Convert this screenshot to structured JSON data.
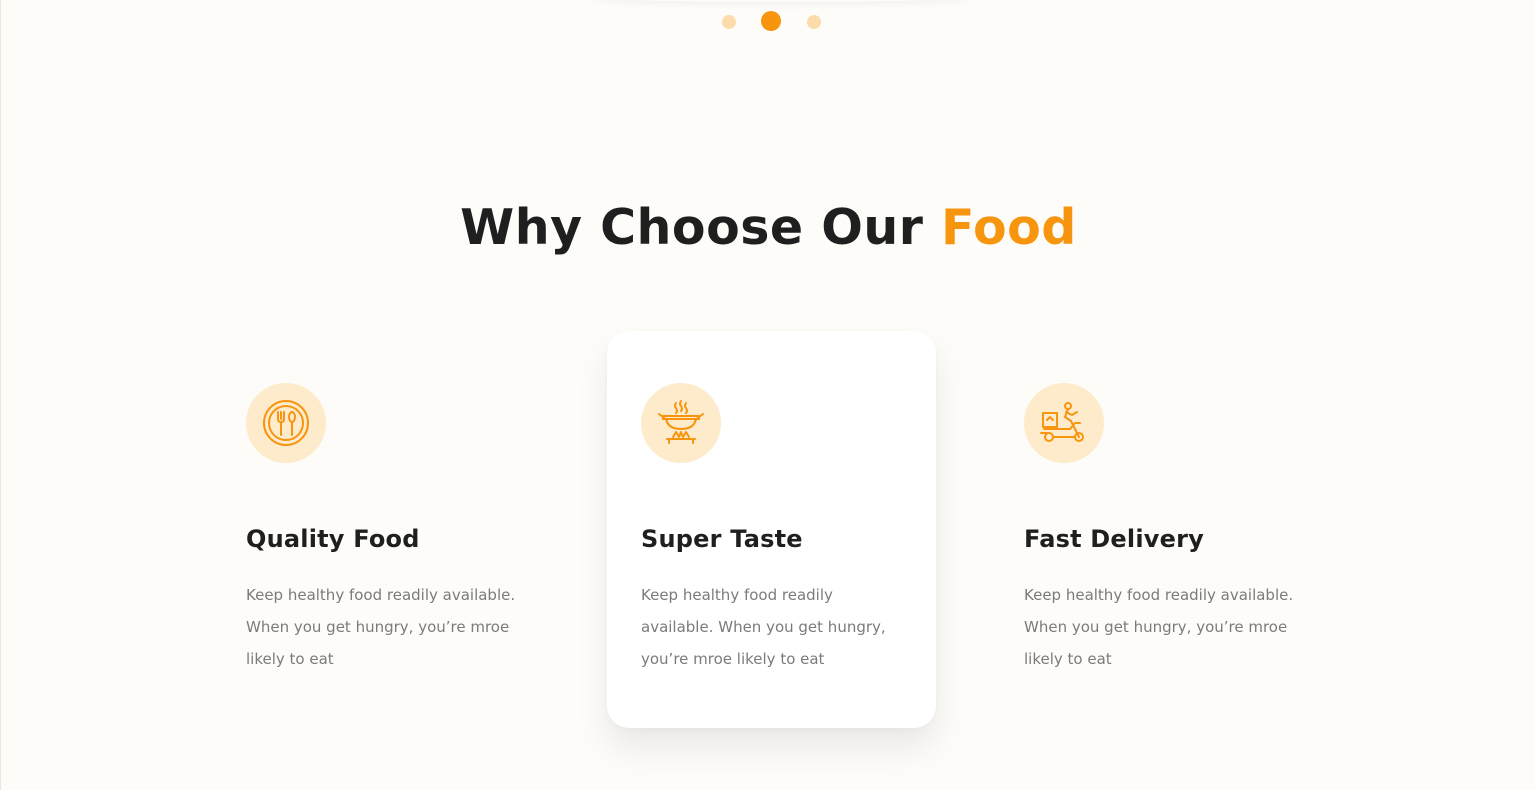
{
  "carousel": {
    "dots": [
      "slide 1",
      "slide 2",
      "slide 3"
    ],
    "active_index": 1
  },
  "section": {
    "heading_main": "Why Choose Our ",
    "heading_accent": "Food"
  },
  "features": [
    {
      "icon": "plate-cutlery-icon",
      "title": "Quality Food",
      "text": "Keep healthy food readily available. When you get hungry, you’re mroe likely to eat"
    },
    {
      "icon": "cooking-pot-icon",
      "title": "Super Taste",
      "text": "Keep healthy food readily available. When you get hungry, you’re mroe likely to eat"
    },
    {
      "icon": "delivery-scooter-icon",
      "title": "Fast Delivery",
      "text": "Keep healthy food readily available. When you get hungry, you’re mroe likely to eat"
    }
  ],
  "colors": {
    "accent": "#f7950f",
    "accent_light": "#fcdcab",
    "icon_bg": "#fdebcb",
    "background": "#fefcf8",
    "heading": "#1f1f1f",
    "body_text": "#7b7b7b"
  }
}
